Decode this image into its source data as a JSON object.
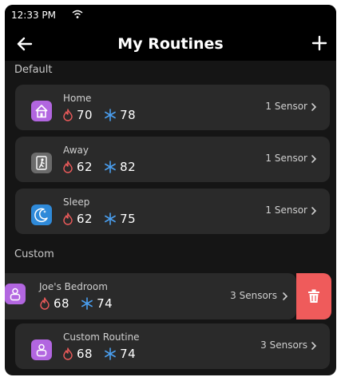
{
  "status": {
    "time": "12:33 PM"
  },
  "header": {
    "title": "My Routines"
  },
  "sections": {
    "default": "Default",
    "custom": "Custom"
  },
  "routines": [
    {
      "name": "Home",
      "heat": "70",
      "cool": "78",
      "sensors": "1 Sensor",
      "icon": "home-icon",
      "icon_color": "#b266e0"
    },
    {
      "name": "Away",
      "heat": "62",
      "cool": "82",
      "sensors": "1 Sensor",
      "icon": "walking-person-icon",
      "icon_color": "#6b6b6b"
    },
    {
      "name": "Sleep",
      "heat": "62",
      "cool": "75",
      "sensors": "1 Sensor",
      "icon": "moon-icon",
      "icon_color": "#2f8ad9"
    },
    {
      "name": "Joe's Bedroom",
      "heat": "68",
      "cool": "74",
      "sensors": "3 Sensors",
      "icon": "person-icon",
      "icon_color": "#b266e0"
    },
    {
      "name": "Custom Routine",
      "heat": "68",
      "cool": "74",
      "sensors": "3 Sensors",
      "icon": "person-icon",
      "icon_color": "#b266e0"
    }
  ],
  "colors": {
    "heat": "#ef5b5b",
    "cool": "#4a9ff0",
    "delete": "#ef5b5b",
    "background": "#151515",
    "card": "#2a2a2a"
  }
}
